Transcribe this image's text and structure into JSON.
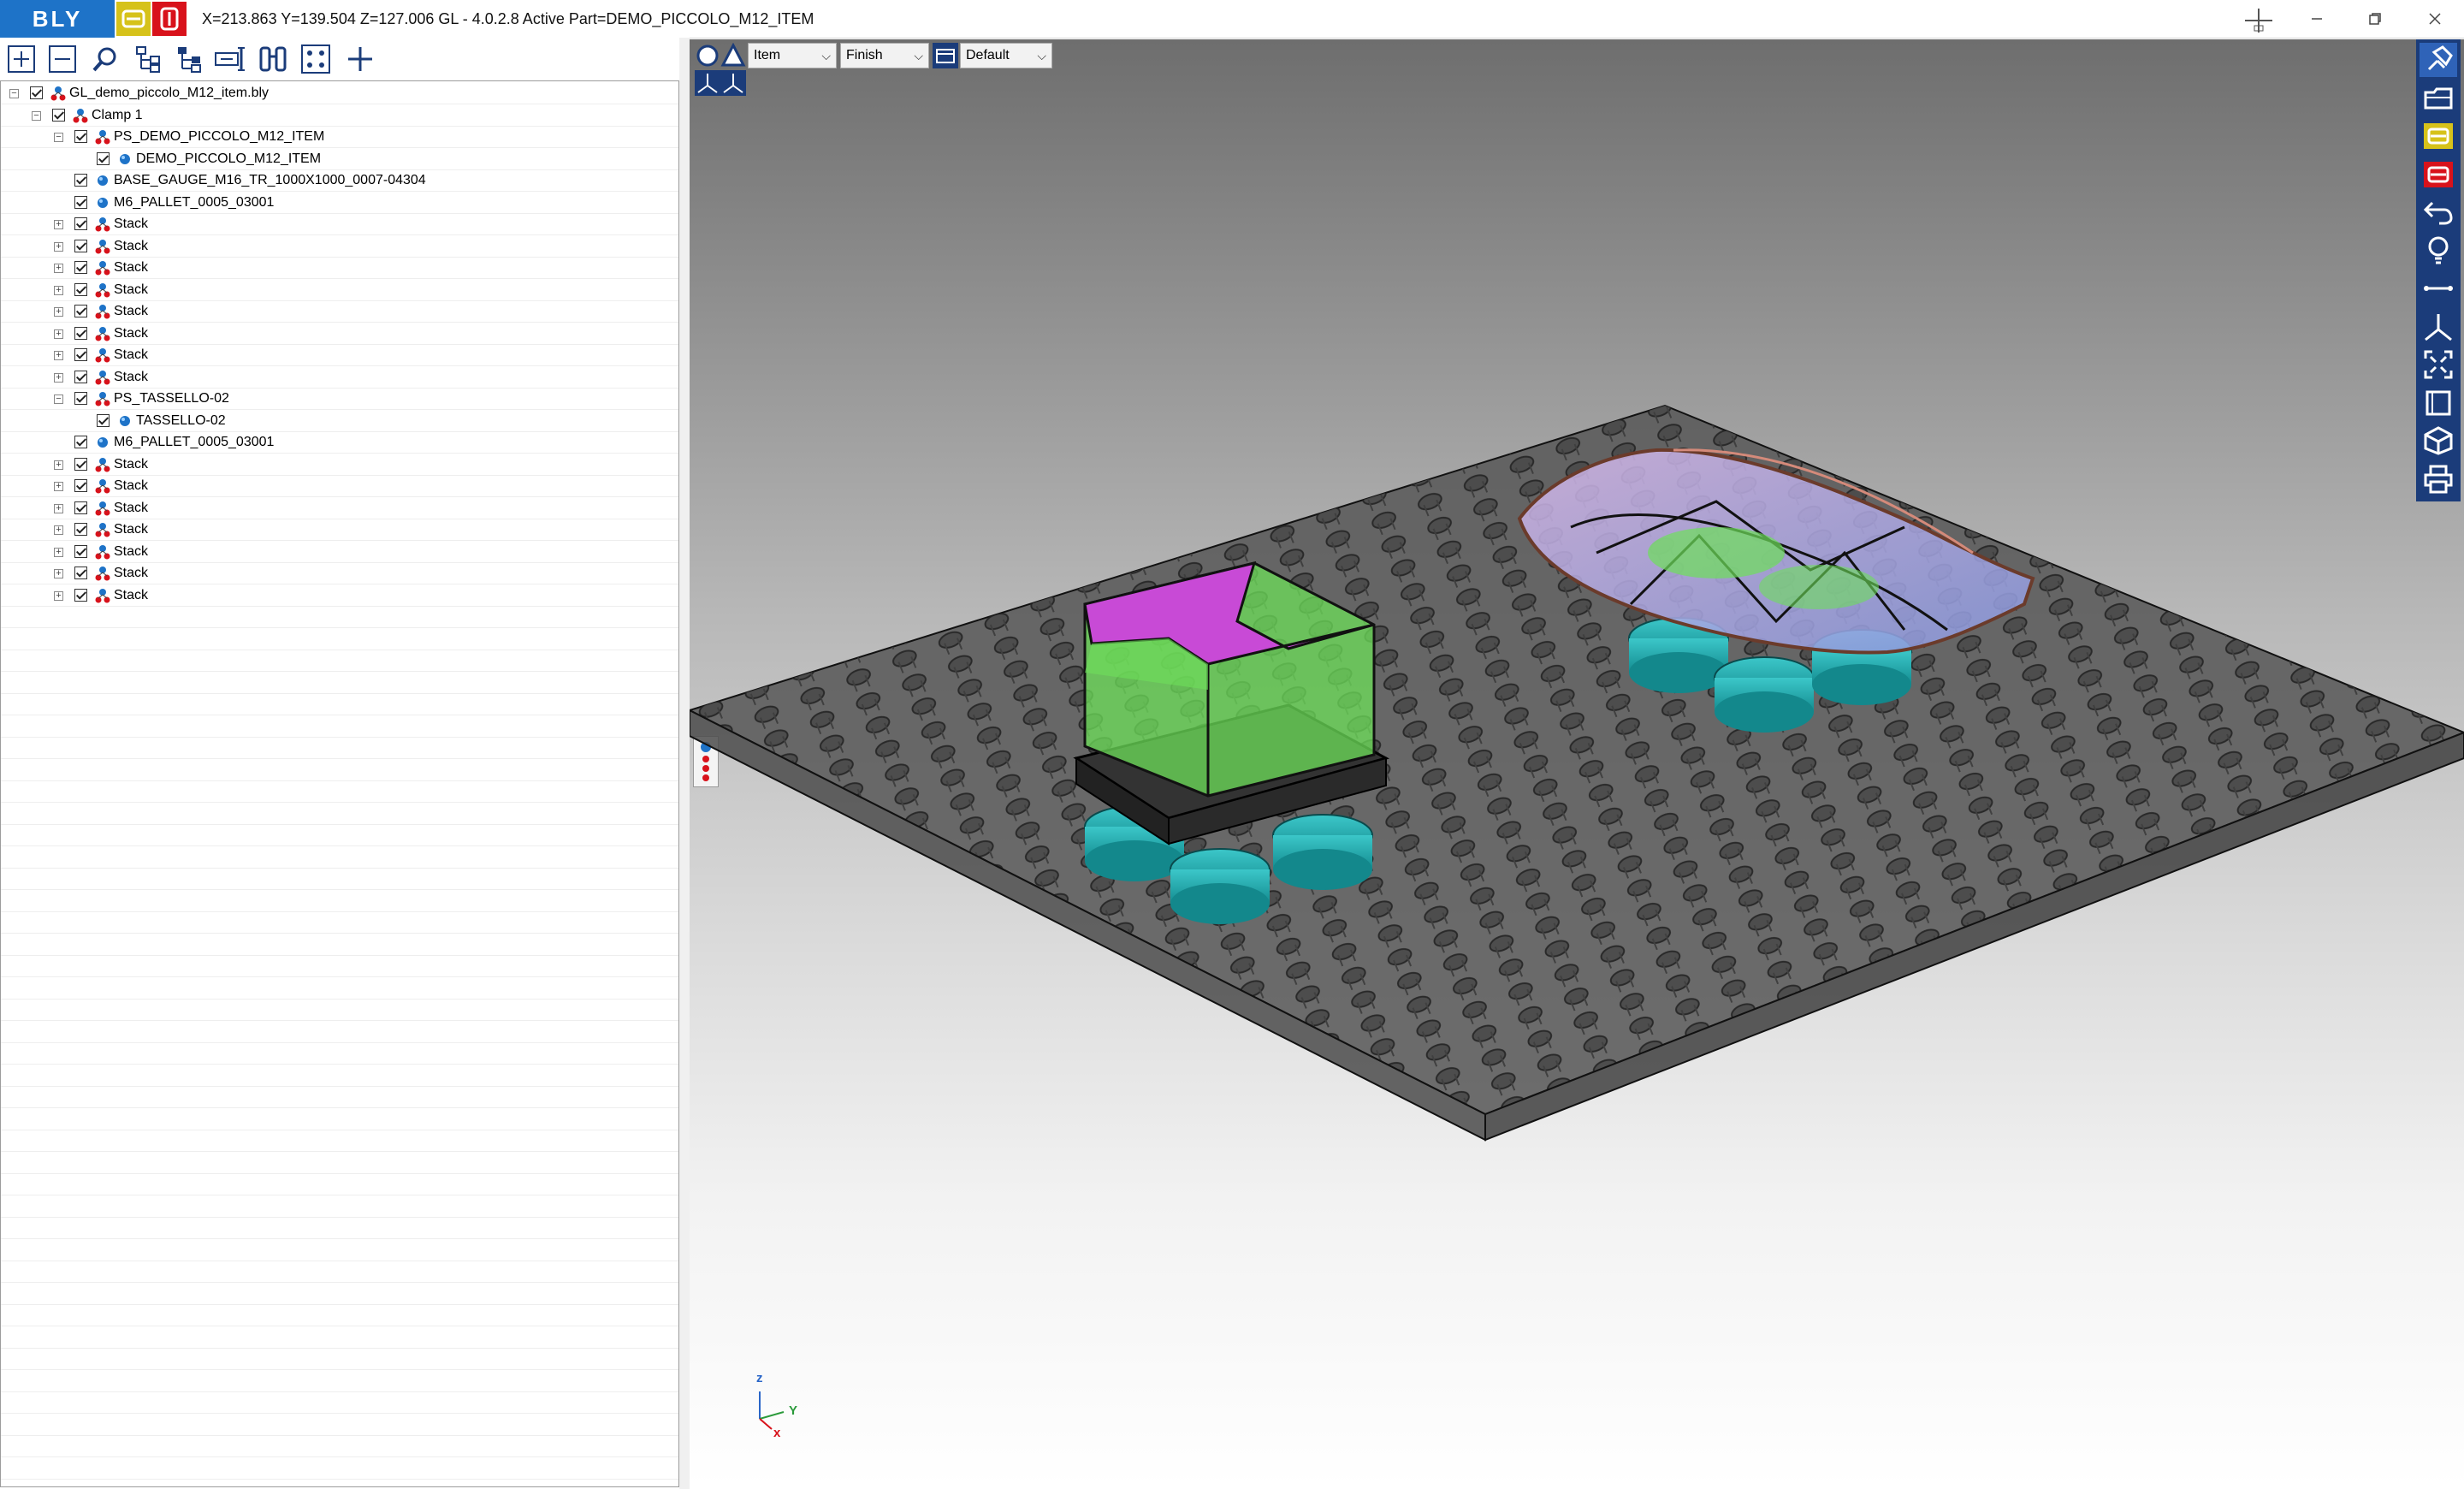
{
  "app": {
    "logo": "BLY",
    "title": "X=213.863 Y=139.504 Z=127.006   GL - 4.0.2.8 Active Part=DEMO_PICCOLO_M12_ITEM"
  },
  "window_controls": [
    "minimize",
    "restore",
    "close"
  ],
  "toolbar_icons": [
    "expand-all-icon",
    "collapse-all-icon",
    "search-icon",
    "tree-structure-icon",
    "tree-branch-icon",
    "measure-icon",
    "binoculars-icon",
    "grid-points-icon",
    "add-icon"
  ],
  "tree": {
    "items": [
      {
        "label": "GL_demo_piccolo_M12_item.bly",
        "level": 0,
        "icon": "assembly"
      },
      {
        "label": "Clamp 1",
        "level": 1,
        "icon": "assembly"
      },
      {
        "label": "PS_DEMO_PICCOLO_M12_ITEM",
        "level": 2,
        "icon": "assembly"
      },
      {
        "label": "DEMO_PICCOLO_M12_ITEM",
        "level": 3,
        "icon": "part"
      },
      {
        "label": "BASE_GAUGE_M16_TR_1000X1000_0007-04304",
        "level": 2,
        "icon": "part"
      },
      {
        "label": "M6_PALLET_0005_03001",
        "level": 2,
        "icon": "part"
      },
      {
        "label": "Stack",
        "level": 2,
        "icon": "assembly"
      },
      {
        "label": "Stack",
        "level": 2,
        "icon": "assembly"
      },
      {
        "label": "Stack",
        "level": 2,
        "icon": "assembly"
      },
      {
        "label": "Stack",
        "level": 2,
        "icon": "assembly"
      },
      {
        "label": "Stack",
        "level": 2,
        "icon": "assembly"
      },
      {
        "label": "Stack",
        "level": 2,
        "icon": "assembly"
      },
      {
        "label": "Stack",
        "level": 2,
        "icon": "assembly"
      },
      {
        "label": "Stack",
        "level": 2,
        "icon": "assembly"
      },
      {
        "label": "PS_TASSELLO-02",
        "level": 2,
        "icon": "assembly"
      },
      {
        "label": "TASSELLO-02",
        "level": 3,
        "icon": "part"
      },
      {
        "label": "M6_PALLET_0005_03001",
        "level": 2,
        "icon": "part"
      },
      {
        "label": "Stack",
        "level": 2,
        "icon": "assembly"
      },
      {
        "label": "Stack",
        "level": 2,
        "icon": "assembly"
      },
      {
        "label": "Stack",
        "level": 2,
        "icon": "assembly"
      },
      {
        "label": "Stack",
        "level": 2,
        "icon": "assembly"
      },
      {
        "label": "Stack",
        "level": 2,
        "icon": "assembly"
      },
      {
        "label": "Stack",
        "level": 2,
        "icon": "assembly"
      },
      {
        "label": "Stack",
        "level": 2,
        "icon": "assembly"
      }
    ]
  },
  "viewport": {
    "mode_combo": "Item",
    "finish_combo": "Finish",
    "view_combo": "Default",
    "axes": {
      "z": "z",
      "y": "Y",
      "x": "x"
    }
  },
  "right_toolbar_icons": [
    "pin-icon",
    "open-folder-icon",
    "yellow-b-icon",
    "red-b-icon",
    "undo-icon",
    "lightbulb-icon",
    "measure-line-icon",
    "axis-icon",
    "fit-view-icon",
    "window-icon",
    "cube-icon",
    "print-icon"
  ],
  "colors": {
    "brand_blue": "#1e73c8",
    "yellow": "#d6c21a",
    "red": "#d8121b",
    "right_toolbar": "#1b3c7a",
    "teal": "#1aa3a8",
    "magenta": "#c040d0",
    "green": "#5fe04a"
  }
}
